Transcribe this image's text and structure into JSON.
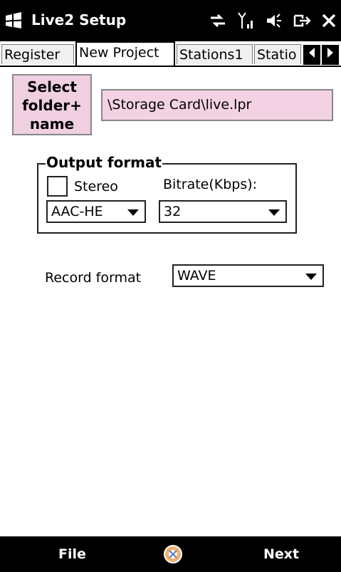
{
  "window": {
    "title": "Live2 Setup"
  },
  "status_icons": [
    "connectivity-icon",
    "signal-icon",
    "volume-icon",
    "battery-icon",
    "close-icon"
  ],
  "tabs": [
    {
      "label": "Register",
      "active": false
    },
    {
      "label": "New Project",
      "active": true
    },
    {
      "label": "Stations1",
      "active": false
    },
    {
      "label": "Statio",
      "active": false
    }
  ],
  "select_button": {
    "line1": "Select",
    "line2": "folder+",
    "line3": "name"
  },
  "path_field": {
    "value": "\\Storage Card\\live.lpr"
  },
  "output_format": {
    "legend": "Output format",
    "stereo_label": "Stereo",
    "stereo_checked": false,
    "bitrate_label": "Bitrate(Kbps):",
    "codec_value": "AAC-HE",
    "bitrate_value": "32"
  },
  "record_format": {
    "label": "Record format",
    "value": "WAVE"
  },
  "softkeys": {
    "left": "File",
    "right": "Next"
  },
  "colors": {
    "titlebar": "#000000",
    "field_pink": "#f3d2e3",
    "button_pink": "#efcfe0"
  }
}
